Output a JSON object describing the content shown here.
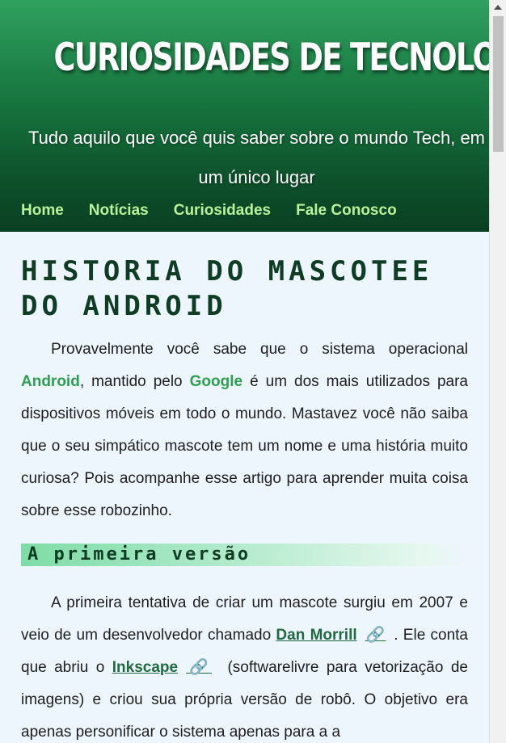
{
  "site": {
    "title": "CURIOSIDADES DE TECNOLOGIA",
    "subtitle": "Tudo aquilo que você quis saber sobre o mundo Tech, em um único lugar"
  },
  "nav": {
    "items": [
      {
        "label": "Home"
      },
      {
        "label": "Notícias"
      },
      {
        "label": "Curiosidades"
      },
      {
        "label": "Fale Conosco"
      }
    ]
  },
  "article": {
    "title": "Historia do Mascotee do Android",
    "intro": {
      "part1": "Provavelmente você sabe que o sistema operacional ",
      "android": "Android",
      "part2": ", mantido pelo ",
      "google": "Google",
      "part3": " é um dos mais utilizados para dispositivos móveis em todo o mundo. Mastavez você não saiba que o seu simpático mascote tem um nome e uma história muito curiosa? Pois acompanhe esse artigo para aprender muita coisa sobre esse robozinho."
    },
    "section1": {
      "heading": "A primeira versão",
      "part1": "A primeira tentativa de criar um mascote surgiu em 2007 e veio de um desenvolvedor chamado ",
      "link1": "Dan Morrill",
      "part2": ". Ele conta que abriu o ",
      "link2": "Inkscape",
      "part3": " (softwarelivre para vetorização de imagens) e criou sua própria versão de robô. O objetivo era apenas personificar o sistema apenas para a a"
    },
    "link_icon": "🔗"
  },
  "icons": {
    "external_link": "link-icon",
    "scroll_up": "chevron-up-icon"
  },
  "colors": {
    "header_top": "#2fa15f",
    "header_bottom": "#0a3f22",
    "nav_link": "#b9f29a",
    "highlight": "#2e9f4f",
    "page_bg": "#eef6fd"
  }
}
